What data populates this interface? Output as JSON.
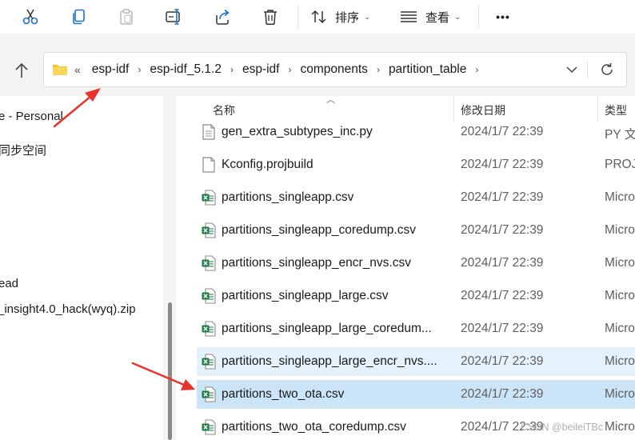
{
  "toolbar": {
    "sort_label": "排序",
    "view_label": "查看",
    "more_label": "•••"
  },
  "address": {
    "lead": "«",
    "crumbs": [
      "esp-idf",
      "esp-idf_5.1.2",
      "esp-idf",
      "components",
      "partition_table"
    ]
  },
  "nav": {
    "items": [
      "e - Personal",
      "同步空间",
      "ead",
      "_insight4.0_hack(wyq).zip"
    ]
  },
  "list": {
    "columns": {
      "name": "名称",
      "date": "修改日期",
      "type": "类型"
    },
    "rows": [
      {
        "name": "gen_extra_subtypes_inc.py",
        "date": "2024/1/7 22:39",
        "type": "PY 文件",
        "icon": "python-file-icon",
        "state": "normal"
      },
      {
        "name": "Kconfig.projbuild",
        "date": "2024/1/7 22:39",
        "type": "PROJB",
        "icon": "generic-file-icon",
        "state": "normal"
      },
      {
        "name": "partitions_singleapp.csv",
        "date": "2024/1/7 22:39",
        "type": "Micro",
        "icon": "excel-csv-icon",
        "state": "normal"
      },
      {
        "name": "partitions_singleapp_coredump.csv",
        "date": "2024/1/7 22:39",
        "type": "Micro",
        "icon": "excel-csv-icon",
        "state": "normal"
      },
      {
        "name": "partitions_singleapp_encr_nvs.csv",
        "date": "2024/1/7 22:39",
        "type": "Micro",
        "icon": "excel-csv-icon",
        "state": "normal"
      },
      {
        "name": "partitions_singleapp_large.csv",
        "date": "2024/1/7 22:39",
        "type": "Micro",
        "icon": "excel-csv-icon",
        "state": "normal"
      },
      {
        "name": "partitions_singleapp_large_coredum...",
        "date": "2024/1/7 22:39",
        "type": "Micro",
        "icon": "excel-csv-icon",
        "state": "normal"
      },
      {
        "name": "partitions_singleapp_large_encr_nvs....",
        "date": "2024/1/7 22:39",
        "type": "Micro",
        "icon": "excel-csv-icon",
        "state": "hover"
      },
      {
        "name": "partitions_two_ota.csv",
        "date": "2024/1/7 22:39",
        "type": "Micro",
        "icon": "excel-csv-icon",
        "state": "selected"
      },
      {
        "name": "partitions_two_ota_coredump.csv",
        "date": "2024/1/7 22:39",
        "type": "Micro",
        "icon": "excel-csv-icon",
        "state": "normal"
      }
    ]
  },
  "watermark": "CSDN @beileiTBc",
  "colors": {
    "accent_blue": "#1a73c8",
    "selected_row": "#cce4f7",
    "hover_row": "#e5f1fb",
    "excel_green": "#1d7a45",
    "folder_yellow": "#f4c430",
    "annotation_red": "#e8322a"
  }
}
